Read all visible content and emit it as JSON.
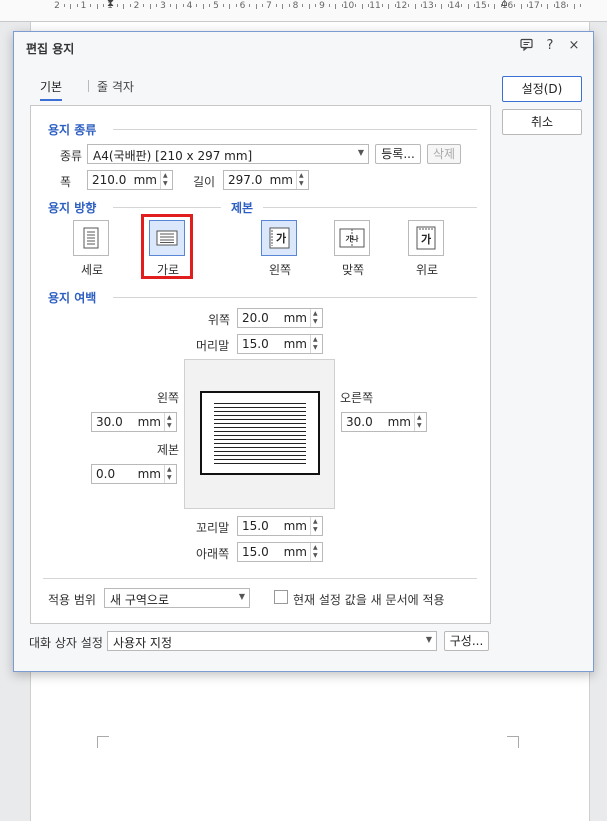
{
  "ruler": {
    "numbers": [
      "2",
      "1",
      "1",
      "2",
      "3",
      "4",
      "5",
      "6",
      "7",
      "8",
      "9",
      "10",
      "11",
      "12",
      "13",
      "14",
      "15",
      "16",
      "17",
      "18"
    ]
  },
  "dialog": {
    "title": "편집 용지",
    "icons": {
      "help_bubble": "comment-icon",
      "help": "?",
      "close": "×"
    },
    "tabs": [
      "기본",
      "줄 격자"
    ],
    "buttons": {
      "ok": "설정(D)",
      "cancel": "취소"
    },
    "paper_type": {
      "section_title": "용지 종류",
      "type_label": "종류",
      "type_value": "A4(국배판) [210 x 297 mm]",
      "register_button": "등록...",
      "delete_button": "삭제",
      "width_label": "폭",
      "width_value": "210.0",
      "height_label": "길이",
      "height_value": "297.0",
      "unit": "mm"
    },
    "orientation": {
      "section_title": "용지 방향",
      "portrait": "세로",
      "landscape": "가로",
      "selected": "가로"
    },
    "binding": {
      "section_title": "제본",
      "left": "왼쪽",
      "facing": "맞쪽",
      "top": "위로",
      "glyph": "가",
      "facing_glyph": "가나",
      "selected": "왼쪽"
    },
    "margins": {
      "section_title": "용지 여백",
      "top_label": "위쪽",
      "top_value": "20.0",
      "header_label": "머리말",
      "header_value": "15.0",
      "left_label": "왼쪽",
      "left_value": "30.0",
      "right_label": "오른쪽",
      "right_value": "30.0",
      "gutter_label": "제본",
      "gutter_value": "0.0",
      "footer_label": "꼬리말",
      "footer_value": "15.0",
      "bottom_label": "아래쪽",
      "bottom_value": "15.0",
      "unit": "mm"
    },
    "apply": {
      "range_label": "적용 범위",
      "range_value": "새 구역으로",
      "default_checkbox_label": "현재 설정 값을 새 문서에 적용",
      "default_checked": false
    },
    "dialog_settings": {
      "label": "대화 상자 설정",
      "value": "사용자 지정",
      "config_button": "구성..."
    }
  },
  "colors": {
    "accent": "#2d5fc2",
    "highlight_box": "#e11d1d",
    "selected_bg": "#dbe8fb"
  }
}
